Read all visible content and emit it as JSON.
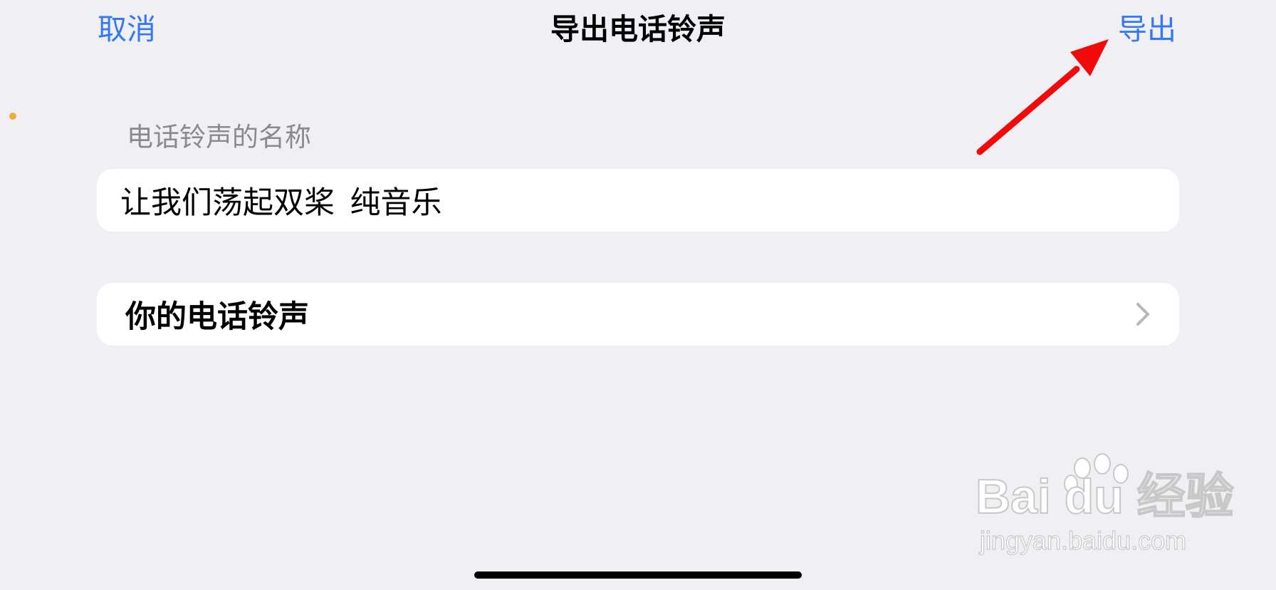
{
  "nav": {
    "cancel_label": "取消",
    "title": "导出电话铃声",
    "export_label": "导出"
  },
  "name_section": {
    "label": "电话铃声的名称",
    "value": "让我们荡起双桨_纯音乐"
  },
  "ringtones_row": {
    "label": "你的电话铃声",
    "icon": "chevron-right-icon"
  },
  "annotation": {
    "arrow_color": "#f00a0a"
  },
  "watermark": {
    "brand": "Bai du 经验",
    "url": "jingyan.baidu.com"
  },
  "colors": {
    "accent": "#3478f6",
    "background": "#f0eff4",
    "card": "#ffffff",
    "secondary_text": "#8a8a8e"
  }
}
